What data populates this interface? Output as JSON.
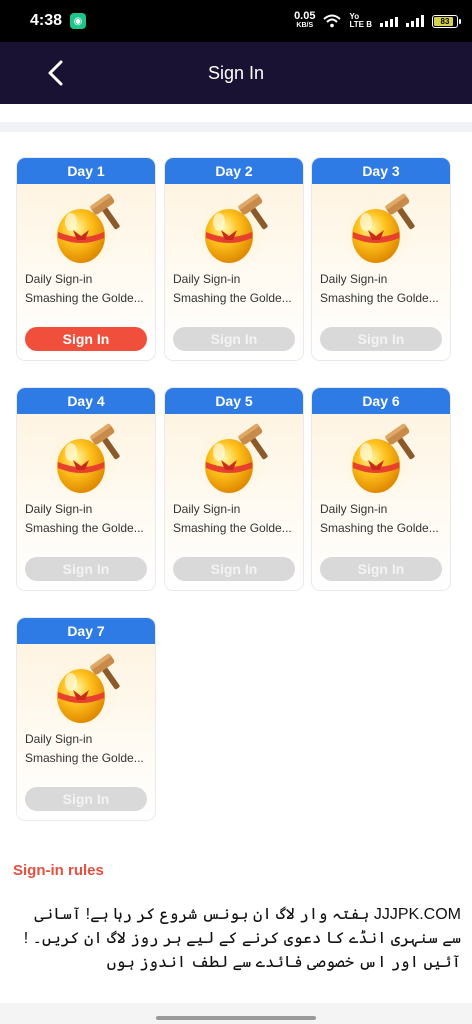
{
  "status_bar": {
    "time": "4:38",
    "net_speed": "0.05",
    "net_unit": "KB/S",
    "volte_top": "Yo",
    "volte_bottom": "LTE B",
    "battery": "83"
  },
  "header": {
    "title": "Sign In"
  },
  "cards": [
    {
      "day": "Day 1",
      "line1": "Daily Sign-in",
      "line2": "Smashing the Golde...",
      "button": "Sign In",
      "active": true
    },
    {
      "day": "Day 2",
      "line1": "Daily Sign-in",
      "line2": "Smashing the Golde...",
      "button": "Sign In",
      "active": false
    },
    {
      "day": "Day 3",
      "line1": "Daily Sign-in",
      "line2": "Smashing the Golde...",
      "button": "Sign In",
      "active": false
    },
    {
      "day": "Day 4",
      "line1": "Daily Sign-in",
      "line2": "Smashing the Golde...",
      "button": "Sign In",
      "active": false
    },
    {
      "day": "Day 5",
      "line1": "Daily Sign-in",
      "line2": "Smashing the Golde...",
      "button": "Sign In",
      "active": false
    },
    {
      "day": "Day 6",
      "line1": "Daily Sign-in",
      "line2": "Smashing the Golde...",
      "button": "Sign In",
      "active": false
    },
    {
      "day": "Day 7",
      "line1": "Daily Sign-in",
      "line2": "Smashing the Golde...",
      "button": "Sign In",
      "active": false
    }
  ],
  "rules": {
    "title": "Sign-in rules",
    "text": "JJJPK.COM ہفتہ وار لاگ ان بونس شروع کر رہا ہے! آسانی سے سنہری انڈے کا دعوی کرنے کے لیے ہر روز لاگ ان کریں۔ !آئیں اور اس خصوصی فائدے سے لطف اندوز ہوں"
  },
  "colors": {
    "header_bg": "#1a1233",
    "day_tab": "#2f7be6",
    "active_button": "#f04f3c",
    "disabled_button": "#d9d9d9",
    "rules_title": "#e5503e"
  },
  "icons": [
    "back-arrow-icon",
    "golden-egg-icon",
    "hammer-icon",
    "wifi-icon",
    "signal-icon",
    "battery-icon"
  ]
}
